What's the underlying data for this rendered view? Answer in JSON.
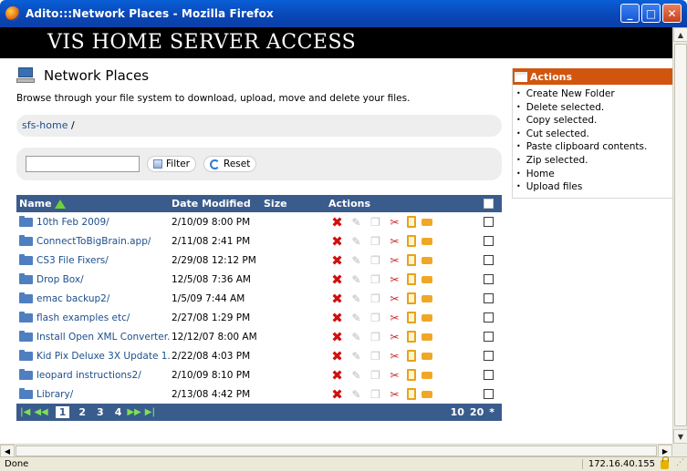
{
  "window": {
    "title": "Adito:::Network Places - Mozilla Firefox"
  },
  "banner": {
    "text": "VIS HOME SERVER ACCESS"
  },
  "page": {
    "title": "Network Places",
    "description": "Browse through your file system to download, upload, move and delete your files."
  },
  "breadcrumb": {
    "root": "sfs-home",
    "separator": "/"
  },
  "filter": {
    "value": "",
    "filter_label": "Filter",
    "reset_label": "Reset"
  },
  "table": {
    "headers": {
      "name": "Name",
      "date": "Date Modified",
      "size": "Size",
      "actions": "Actions"
    },
    "rows": [
      {
        "name": "10th Feb 2009/",
        "date": "2/10/09 8:00 PM"
      },
      {
        "name": "ConnectToBigBrain.app/",
        "date": "2/11/08 2:41 PM"
      },
      {
        "name": "CS3 File Fixers/",
        "date": "2/29/08 12:12 PM"
      },
      {
        "name": "Drop Box/",
        "date": "12/5/08 7:36 AM"
      },
      {
        "name": "emac backup2/",
        "date": "1/5/09 7:44 AM"
      },
      {
        "name": "flash examples etc/",
        "date": "2/27/08 1:29 PM"
      },
      {
        "name": "Install Open XML Converter.",
        "date": "12/12/07 8:00 AM"
      },
      {
        "name": "Kid Pix Deluxe 3X Update 1.:",
        "date": "2/22/08 4:03 PM"
      },
      {
        "name": "leopard instructions2/",
        "date": "2/10/09 8:10 PM"
      },
      {
        "name": "Library/",
        "date": "2/13/08 4:42 PM"
      }
    ],
    "pagination": {
      "pages": [
        "1",
        "2",
        "3",
        "4"
      ],
      "current": "1",
      "per_page": [
        "10",
        "20",
        "*"
      ]
    }
  },
  "sidebar": {
    "title": "Actions",
    "items": [
      "Create New Folder",
      "Delete selected.",
      "Copy selected.",
      "Cut selected.",
      "Paste clipboard contents.",
      "Zip selected.",
      "Home",
      "Upload files"
    ]
  },
  "status": {
    "text": "Done",
    "ip": "172.16.40.155"
  },
  "colors": {
    "banner": "#000000",
    "table_header": "#3a5c8c",
    "sidebar_header": "#d2550e",
    "link": "#1d4f8c"
  },
  "icons": [
    "firefox-icon",
    "computer-icon",
    "folder-icon",
    "delete-icon",
    "rename-icon",
    "copy-icon",
    "cut-icon",
    "paste-icon",
    "zip-icon",
    "lock-icon"
  ]
}
